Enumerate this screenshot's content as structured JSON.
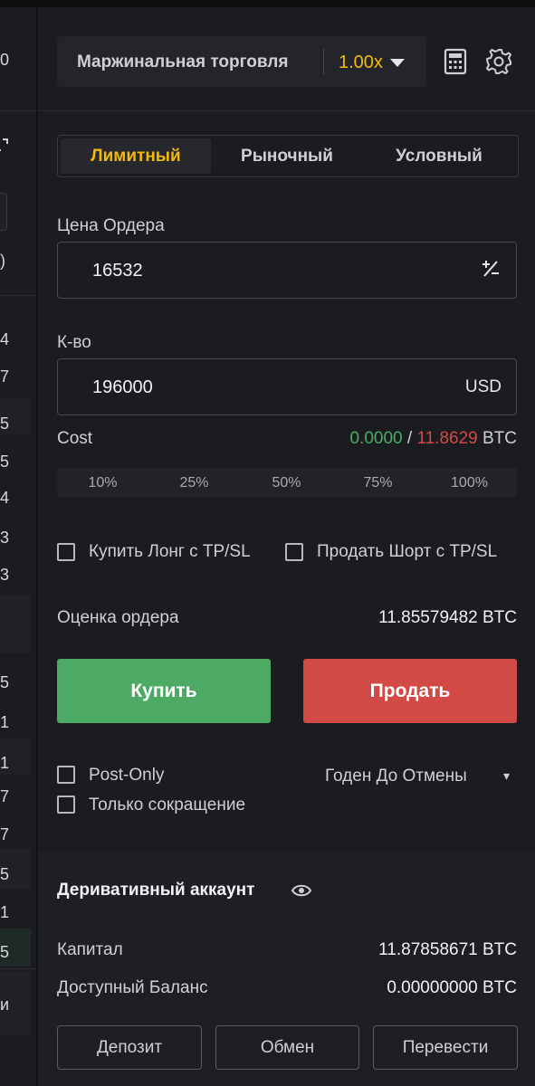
{
  "left_panel": {
    "numbers": [
      "0",
      ")",
      "4",
      "7",
      "5",
      "5",
      "4",
      "3",
      "3",
      "5",
      "1",
      "1",
      "7",
      "7",
      "5",
      "1",
      "5",
      "и"
    ]
  },
  "header": {
    "mode_label": "Маржинальная торговля",
    "leverage": "1.00x",
    "calculator_icon": "calculator-icon",
    "settings_icon": "gear-icon"
  },
  "order_tabs": [
    {
      "label": "Лимитный",
      "active": true
    },
    {
      "label": "Рыночный",
      "active": false
    },
    {
      "label": "Условный",
      "active": false
    }
  ],
  "price": {
    "label": "Цена Ордера",
    "value": "16532"
  },
  "qty": {
    "label": "К-во",
    "value": "196000",
    "unit": "USD"
  },
  "cost": {
    "label": "Cost",
    "buy": "0.0000",
    "sep": "/",
    "sell": "11.8629",
    "unit": "BTC"
  },
  "percent_buttons": [
    "10%",
    "25%",
    "50%",
    "75%",
    "100%"
  ],
  "tpsl": {
    "buy_long": "Купить Лонг с TP/SL",
    "sell_short": "Продать Шорт с TP/SL"
  },
  "estimate": {
    "label": "Оценка ордера",
    "value": "11.85579482 BTC"
  },
  "actions": {
    "buy": "Купить",
    "sell": "Продать"
  },
  "options": {
    "post_only": "Post-Only",
    "reduce_only": "Только сокращение",
    "tif": "Годен До Отмены",
    "tif_caret": "▾"
  },
  "account": {
    "title": "Деривативный аккаунт",
    "equity_label": "Капитал",
    "equity_value": "11.87858671 BTC",
    "available_label": "Доступный Баланс",
    "available_value": "0.00000000 BTC",
    "deposit": "Депозит",
    "exchange": "Обмен",
    "transfer": "Перевести"
  },
  "colors": {
    "accent": "#f0b90b",
    "buy": "#4caa64",
    "sell": "#d24a45"
  }
}
